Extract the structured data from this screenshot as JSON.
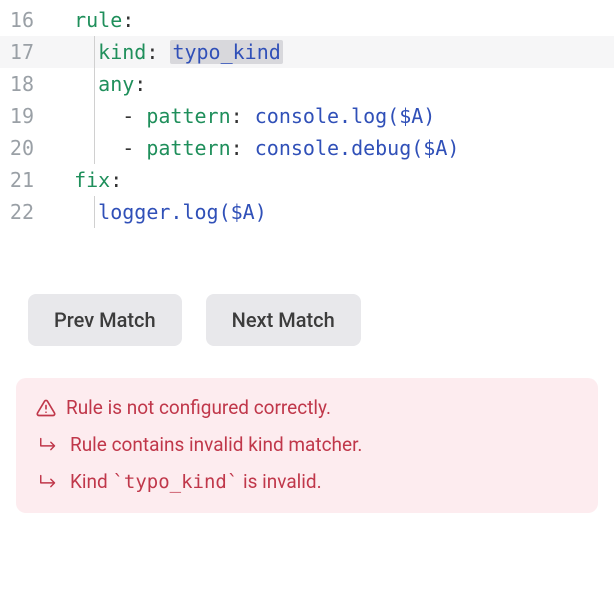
{
  "code": {
    "lines": [
      {
        "num": "16",
        "indent": 1,
        "key": "rule",
        "value": ""
      },
      {
        "num": "17",
        "indent": 2,
        "key": "kind",
        "value": "typo_kind",
        "highlighted": true,
        "value_selected": true
      },
      {
        "num": "18",
        "indent": 2,
        "key": "any",
        "value": ""
      },
      {
        "num": "19",
        "indent": 3,
        "dash": true,
        "key": "pattern",
        "value": "console.log($A)"
      },
      {
        "num": "20",
        "indent": 3,
        "dash": true,
        "key": "pattern",
        "value": "console.debug($A)"
      },
      {
        "num": "21",
        "indent": 1,
        "key": "fix",
        "value": ""
      },
      {
        "num": "22",
        "indent": 2,
        "raw": "logger.log($A)"
      }
    ]
  },
  "buttons": {
    "prev": "Prev Match",
    "next": "Next Match"
  },
  "errors": {
    "main": "Rule is not configured correctly.",
    "sub1": "Rule contains invalid kind matcher.",
    "sub2_prefix": "Kind ",
    "sub2_code": "`typo_kind`",
    "sub2_suffix": " is invalid."
  }
}
